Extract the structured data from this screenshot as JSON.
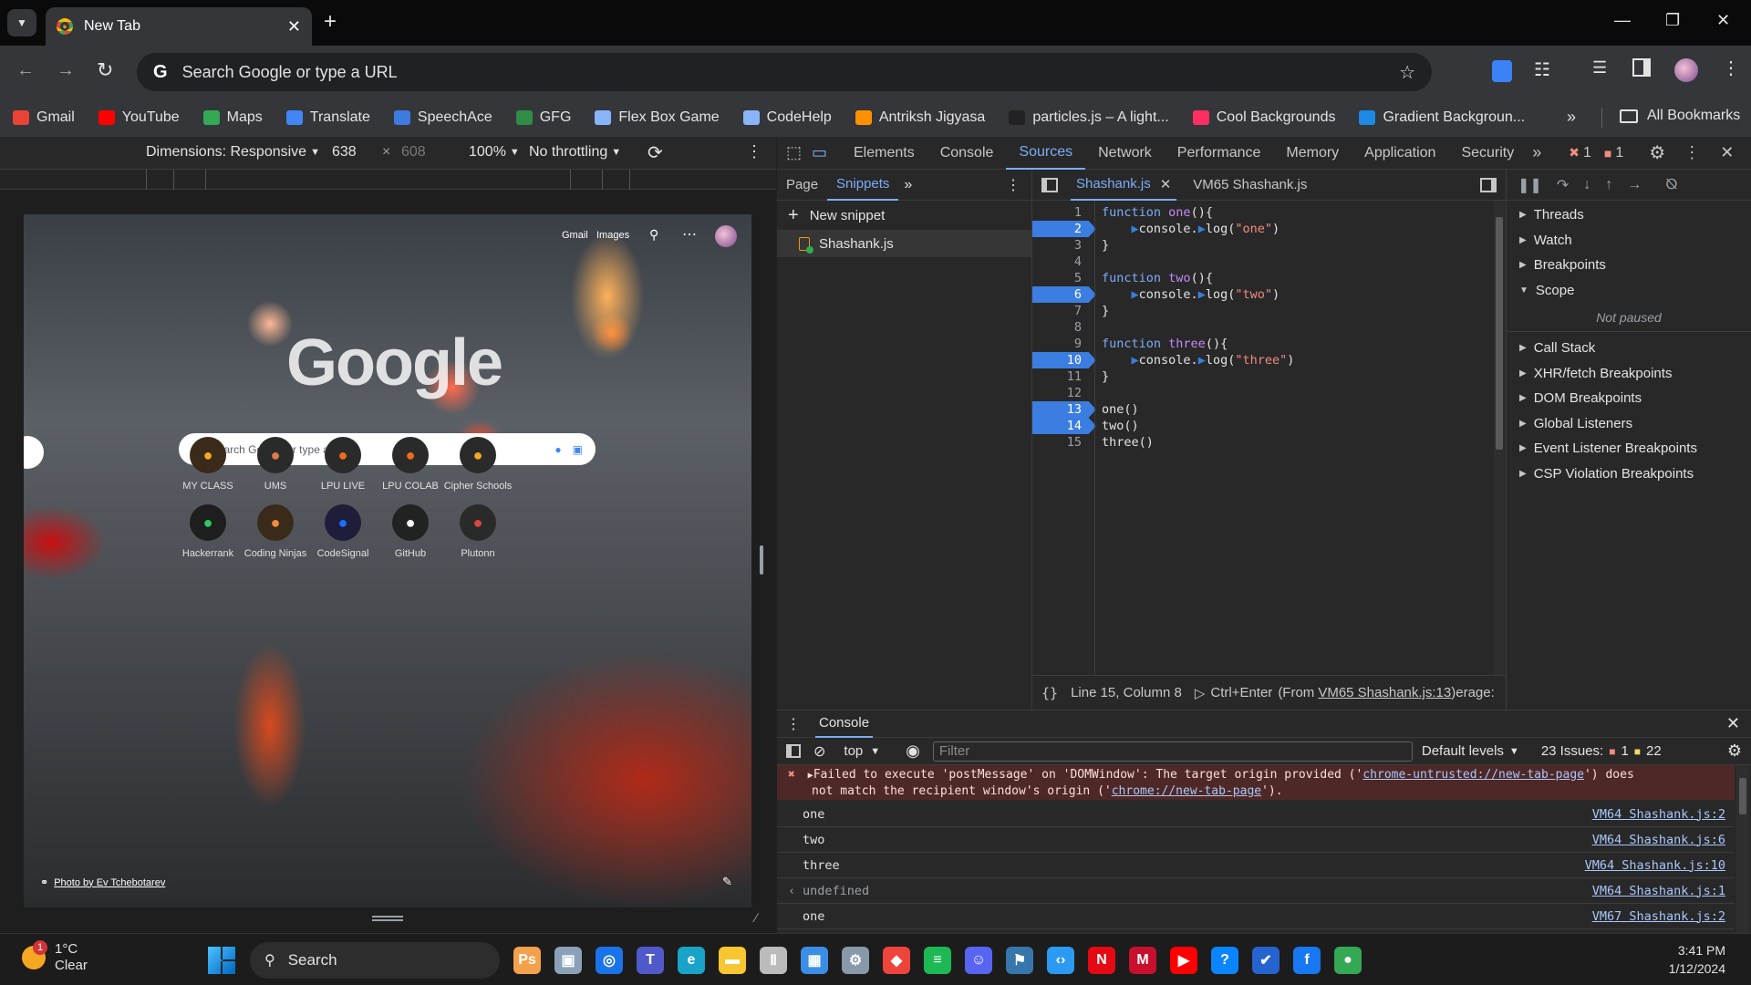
{
  "browser": {
    "tab_title": "New Tab",
    "omnibox_placeholder": "Search Google or type a URL",
    "bookmarks": [
      {
        "label": "Gmail",
        "color": "#ea4335"
      },
      {
        "label": "YouTube",
        "color": "#ff0000"
      },
      {
        "label": "Maps",
        "color": "#34a853"
      },
      {
        "label": "Translate",
        "color": "#4285f4"
      },
      {
        "label": "SpeechAce",
        "color": "#3d7be0"
      },
      {
        "label": "GFG",
        "color": "#2f8d46"
      },
      {
        "label": "Flex Box Game",
        "color": "#8ab4f8"
      },
      {
        "label": "CodeHelp",
        "color": "#8ab4f8"
      },
      {
        "label": "Antriksh Jigyasa",
        "color": "#ff9100"
      },
      {
        "label": "particles.js – A light...",
        "color": "#222222"
      },
      {
        "label": "Cool Backgrounds",
        "color": "#ff2e63"
      },
      {
        "label": "Gradient Backgroun...",
        "color": "#1e88e5"
      }
    ],
    "all_bookmarks": "All Bookmarks"
  },
  "device_toolbar": {
    "dimensions": "Dimensions: Responsive",
    "width": "638",
    "times": "×",
    "height": "608",
    "zoom": "100%",
    "throttling": "No throttling"
  },
  "ntp": {
    "gmail": "Gmail",
    "images": "Images",
    "logo": "Google",
    "search_placeholder": "Search Google or type a URL",
    "shortcuts_row1": [
      "MY CLASS",
      "UMS",
      "LPU LIVE",
      "LPU COLAB",
      "Cipher Schools"
    ],
    "shortcuts_row2": [
      "Hackerrank",
      "Coding Ninjas",
      "CodeSignal",
      "GitHub",
      "Plutonn"
    ],
    "photo_credit": "Photo by Ev Tchebotarev"
  },
  "devtools": {
    "tabs": [
      "Elements",
      "Console",
      "Sources",
      "Network",
      "Performance",
      "Memory",
      "Application",
      "Security"
    ],
    "active_tab": "Sources",
    "error_count": "1",
    "warning_count": "1",
    "nav_tabs": [
      "Page",
      "Snippets"
    ],
    "new_snippet": "New snippet",
    "snippet_file": "Shashank.js",
    "editor_tabs": [
      "Shashank.js",
      "VM65 Shashank.js"
    ],
    "code_lines": [
      {
        "n": "1",
        "bp": false
      },
      {
        "n": "2",
        "bp": true
      },
      {
        "n": "3",
        "bp": false
      },
      {
        "n": "4",
        "bp": false
      },
      {
        "n": "5",
        "bp": false
      },
      {
        "n": "6",
        "bp": true
      },
      {
        "n": "7",
        "bp": false
      },
      {
        "n": "8",
        "bp": false
      },
      {
        "n": "9",
        "bp": false
      },
      {
        "n": "10",
        "bp": true
      },
      {
        "n": "11",
        "bp": false
      },
      {
        "n": "12",
        "bp": false
      },
      {
        "n": "13",
        "bp": true
      },
      {
        "n": "14",
        "bp": true
      },
      {
        "n": "15",
        "bp": false
      }
    ],
    "code": {
      "l1a": "function",
      "l1b": "one",
      "l1c": "(){",
      "l2a": "console.",
      "l2b": "log(",
      "l2c": "\"one\"",
      "l2d": ")",
      "l3": "}",
      "l5a": "function",
      "l5b": "two",
      "l5c": "(){",
      "l6a": "console.",
      "l6b": "log(",
      "l6c": "\"two\"",
      "l6d": ")",
      "l7": "}",
      "l9a": "function",
      "l9b": "three",
      "l9c": "(){",
      "l10a": "console.",
      "l10b": "log(",
      "l10c": "\"three\"",
      "l10d": ")",
      "l11": "}",
      "l13": "one()",
      "l14": "two()",
      "l15": "three()"
    },
    "status_position": "Line 15, Column 8",
    "status_run": "Ctrl+Enter",
    "status_from": "(From",
    "status_link": "VM65 Shashank.js:13",
    "status_tail": ")erage:",
    "debugger_sections": [
      "Threads",
      "Watch",
      "Breakpoints",
      "Scope"
    ],
    "not_paused": "Not paused",
    "debugger_sections2": [
      "Call Stack",
      "XHR/fetch Breakpoints",
      "DOM Breakpoints",
      "Global Listeners",
      "Event Listener Breakpoints",
      "CSP Violation Breakpoints"
    ]
  },
  "console": {
    "title": "Console",
    "context": "top",
    "filter_placeholder": "Filter",
    "levels": "Default levels",
    "issues_label": "23 Issues:",
    "issues_err": "1",
    "issues_warn": "22",
    "error_line1": "Failed to execute 'postMessage' on 'DOMWindow': The target origin provided ('",
    "error_link1": "chrome-untrusted://new-tab-page",
    "error_line1b": "') does",
    "error_line2": "not match the recipient window's origin ('",
    "error_link2": "chrome://new-tab-page",
    "error_line2b": "').",
    "logs": [
      {
        "text": "one",
        "src": "VM64 Shashank.js:2"
      },
      {
        "text": "two",
        "src": "VM64 Shashank.js:6"
      },
      {
        "text": "three",
        "src": "VM64 Shashank.js:10"
      },
      {
        "text": "undefined",
        "src": "VM64 Shashank.js:1"
      },
      {
        "text": "one",
        "src": "VM67 Shashank.js:2"
      }
    ]
  },
  "taskbar": {
    "weather_temp": "1°C",
    "weather_desc": "Clear",
    "weather_badge": "1",
    "search": "Search",
    "time": "3:41 PM",
    "date": "1/12/2024"
  }
}
